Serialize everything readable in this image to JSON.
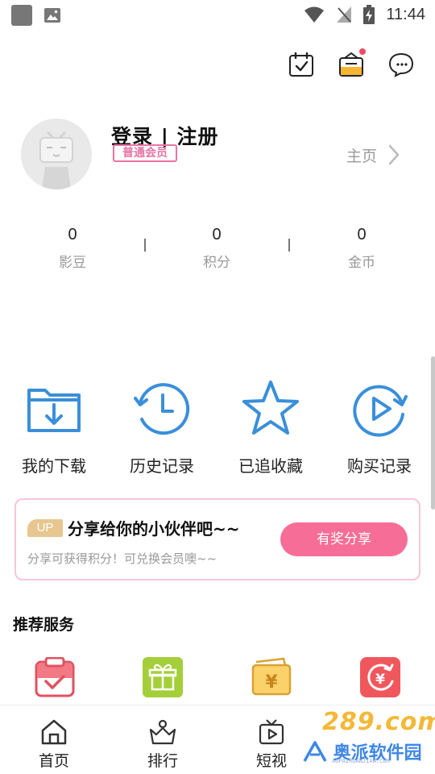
{
  "status_bar": {
    "time": "11:44"
  },
  "profile": {
    "title": "登录 | 注册",
    "member_badge": "普通会员",
    "homepage_link": "主页"
  },
  "stats": [
    {
      "value": "0",
      "label": "影豆"
    },
    {
      "value": "0",
      "label": "积分"
    },
    {
      "value": "0",
      "label": "金币"
    }
  ],
  "quick_actions": [
    {
      "label": "我的下载",
      "icon": "download-folder-icon"
    },
    {
      "label": "历史记录",
      "icon": "history-clock-icon"
    },
    {
      "label": "已追收藏",
      "icon": "star-icon"
    },
    {
      "label": "购买记录",
      "icon": "play-circle-icon"
    }
  ],
  "share_banner": {
    "badge": "UP",
    "title": "分享给你的小伙伴吧~~",
    "subtitle": "分享可获得积分！可兑换会员噢~~",
    "button": "有奖分享"
  },
  "recommended": {
    "title": "推荐服务"
  },
  "bottom_nav": [
    {
      "label": "首页",
      "icon": "home-icon"
    },
    {
      "label": "排行",
      "icon": "rank-icon"
    },
    {
      "label": "短视",
      "icon": "short-video-icon"
    }
  ],
  "watermark": {
    "top": "289.com",
    "bottom": "奥派软件园",
    "small": "AOPAIRUANJIAN.COM"
  },
  "colors": {
    "accent_blue": "#3a8fd9",
    "pink": "#f66e98",
    "badge_pink": "#e774a5",
    "gold": "#e7c690"
  }
}
